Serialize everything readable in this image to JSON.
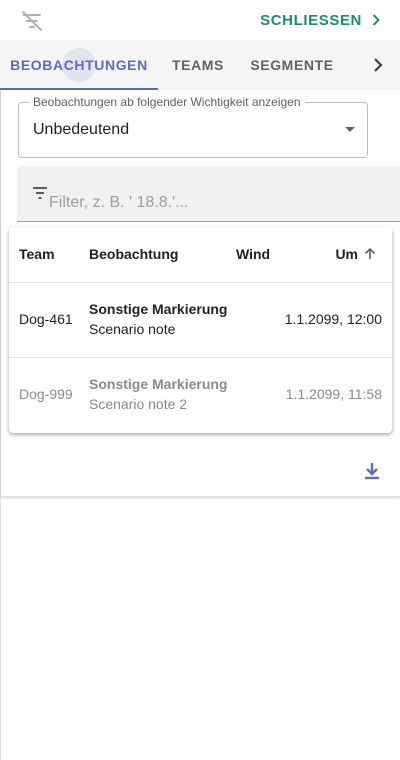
{
  "header": {
    "close_label": "SCHLIESSEN",
    "filter_off_icon": "filter-off-icon",
    "chevron_icon": "chevron-right-icon"
  },
  "tabs": [
    {
      "label": "BEOBACHTUNGEN",
      "active": true
    },
    {
      "label": "TEAMS",
      "active": false
    },
    {
      "label": "SEGMENTE",
      "active": false
    }
  ],
  "importance_select": {
    "label": "Beobachtungen ab folgender Wichtigkeit anzeigen",
    "value": "Unbedeutend"
  },
  "filter": {
    "placeholder": "Filter, z. B. ' 18.8.'..."
  },
  "table": {
    "columns": [
      "Team",
      "Beobachtung",
      "Wind",
      "Um"
    ],
    "sort_column": "Um",
    "sort_direction": "ascending",
    "rows": [
      {
        "team": "Dog-461",
        "title": "Sonstige Markierung",
        "note": "Scenario note",
        "wind": "",
        "um": "1.1.2099, 12:00"
      },
      {
        "team": "Dog-999",
        "title": "Sonstige Markierung",
        "note": "Scenario note 2",
        "wind": "",
        "um": "1.1.2099, 11:58"
      }
    ]
  },
  "colors": {
    "accent": "#5c6bc0",
    "close_text": "#1e8a7a",
    "dimmed_row": "#8a8a8a"
  }
}
